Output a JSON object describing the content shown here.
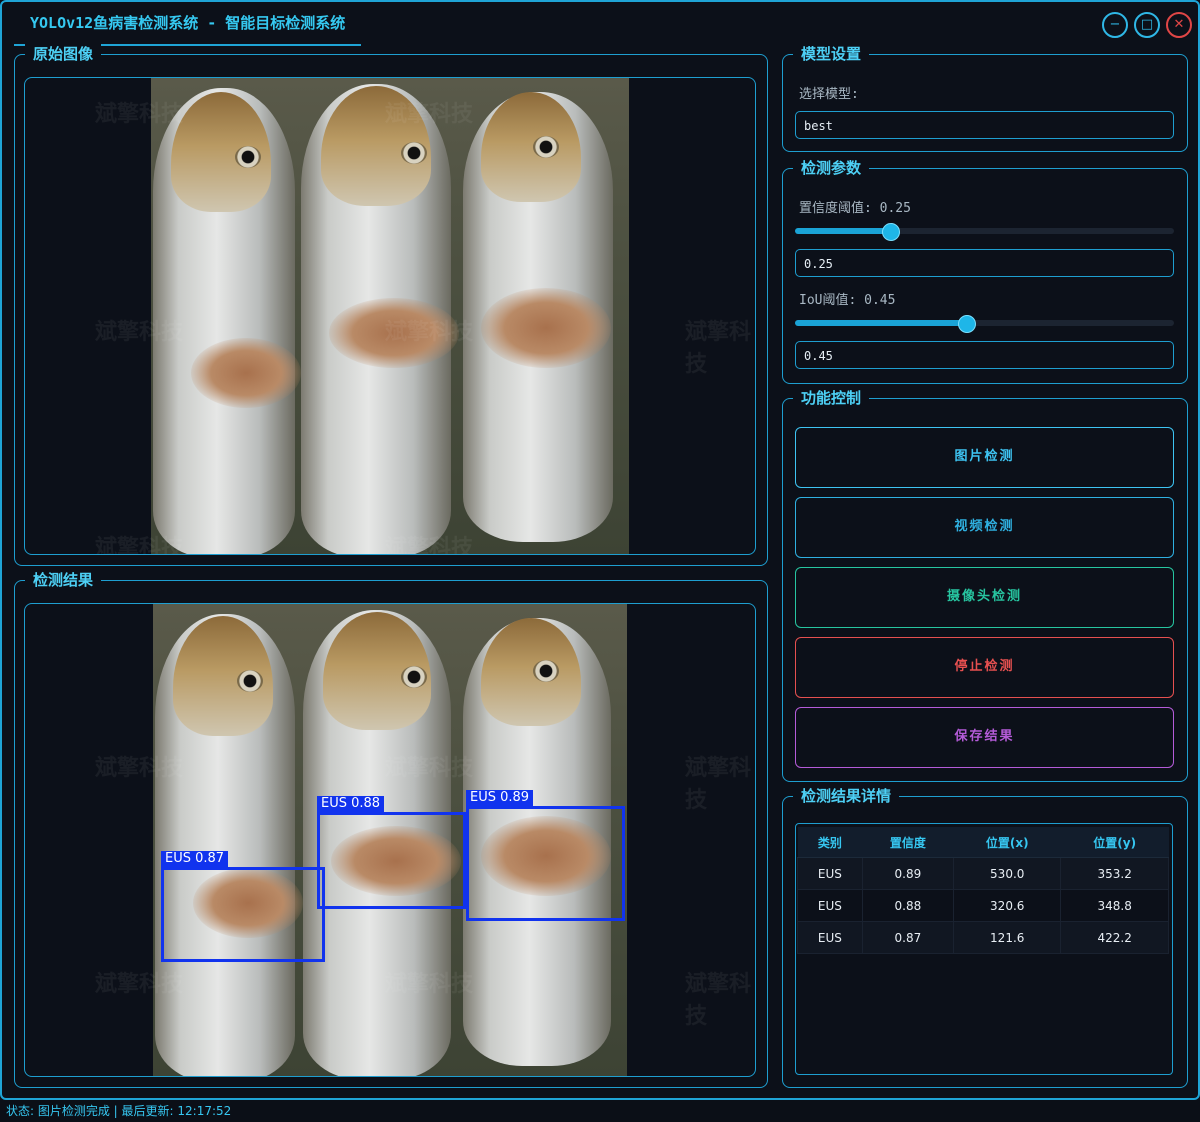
{
  "window": {
    "title": "YOLOv12鱼病害检测系统 - 智能目标检测系统",
    "controls": {
      "minimize": "−",
      "maximize": "□",
      "close": "✕"
    }
  },
  "original_panel": {
    "title": "原始图像"
  },
  "result_panel": {
    "title": "检测结果",
    "detections_drawn": [
      {
        "label": "EUS 0.88"
      },
      {
        "label": "EUS 0.89"
      },
      {
        "label": "EUS 0.87"
      }
    ]
  },
  "watermark_text": "斌擎科技",
  "model_settings": {
    "title": "模型设置",
    "select_label": "选择模型:",
    "selected_model": "best"
  },
  "detect_params": {
    "title": "检测参数",
    "confidence_label": "置信度阈值: 0.25",
    "confidence_value": "0.25",
    "confidence_level": 0.25,
    "iou_label": "IoU阈值: 0.45",
    "iou_value": "0.45",
    "iou_level": 0.45
  },
  "function_control": {
    "title": "功能控制",
    "buttons": [
      {
        "label": "图片检测",
        "color": "#3ec4f2"
      },
      {
        "label": "视频检测",
        "color": "#2fb0e0"
      },
      {
        "label": "摄像头检测",
        "color": "#27c5a0"
      },
      {
        "label": "停止检测",
        "color": "#e65050"
      },
      {
        "label": "保存结果",
        "color": "#b45bd8"
      }
    ]
  },
  "result_details": {
    "title": "检测结果详情",
    "columns": [
      "类别",
      "置信度",
      "位置(x)",
      "位置(y)"
    ],
    "rows": [
      [
        "EUS",
        "0.89",
        "530.0",
        "353.2"
      ],
      [
        "EUS",
        "0.88",
        "320.6",
        "348.8"
      ],
      [
        "EUS",
        "0.87",
        "121.6",
        "422.2"
      ]
    ]
  },
  "statusbar": {
    "text": "状态: 图片检测完成 | 最后更新: 12:17:52"
  },
  "colors": {
    "accent": "#1e9ed0",
    "bbox": "#1133ee",
    "background": "#0c1019"
  }
}
